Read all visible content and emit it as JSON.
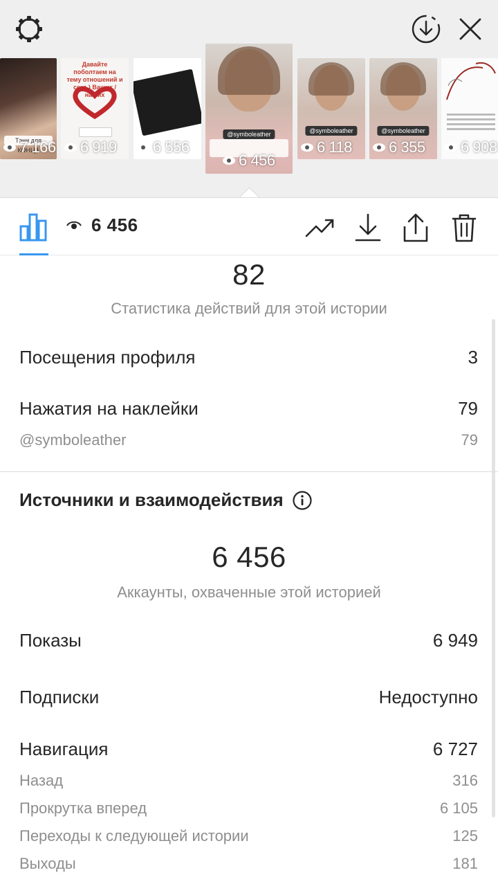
{
  "stories": [
    {
      "views": "7 166",
      "caption": "Тэни для КОНЦА"
    },
    {
      "views": "6 919",
      "overlay": "Давайте поболтаем на тему отношений и секс ) Ваших / наших"
    },
    {
      "views": "6 556"
    },
    {
      "views": "6 456",
      "handle": "@symboleather"
    },
    {
      "views": "6 118",
      "handle": "@symboleather"
    },
    {
      "views": "6 355",
      "handle": "@symboleather"
    },
    {
      "views": "6 908"
    }
  ],
  "toolbar": {
    "views": "6 456"
  },
  "actions": {
    "total": "82",
    "caption": "Статистика действий для этой истории",
    "profile_visits_label": "Посещения профиля",
    "profile_visits_value": "3",
    "sticker_taps_label": "Нажатия на наклейки",
    "sticker_taps_value": "79",
    "sticker_handle_label": "@symboleather",
    "sticker_handle_value": "79"
  },
  "discovery": {
    "title": "Источники и взаимодействия",
    "reach": "6 456",
    "reach_caption": "Аккаунты, охваченные этой историей",
    "impressions_label": "Показы",
    "impressions_value": "6 949",
    "follows_label": "Подписки",
    "follows_value": "Недоступно",
    "navigation_label": "Навигация",
    "navigation_value": "6 727",
    "back_label": "Назад",
    "back_value": "316",
    "forward_label": "Прокрутка вперед",
    "forward_value": "6 105",
    "next_story_label": "Переходы к следующей истории",
    "next_story_value": "125",
    "exits_label": "Выходы",
    "exits_value": "181"
  },
  "colors": {
    "accent": "#3897f0",
    "text_primary": "#262626",
    "text_secondary": "#8e8e8e",
    "strip_background": "#efefef"
  },
  "icons": [
    "settings-icon",
    "download-circle-icon",
    "close-icon",
    "bar-chart-icon",
    "eye-icon",
    "trend-icon",
    "download-icon",
    "share-icon",
    "trash-icon",
    "info-icon"
  ]
}
